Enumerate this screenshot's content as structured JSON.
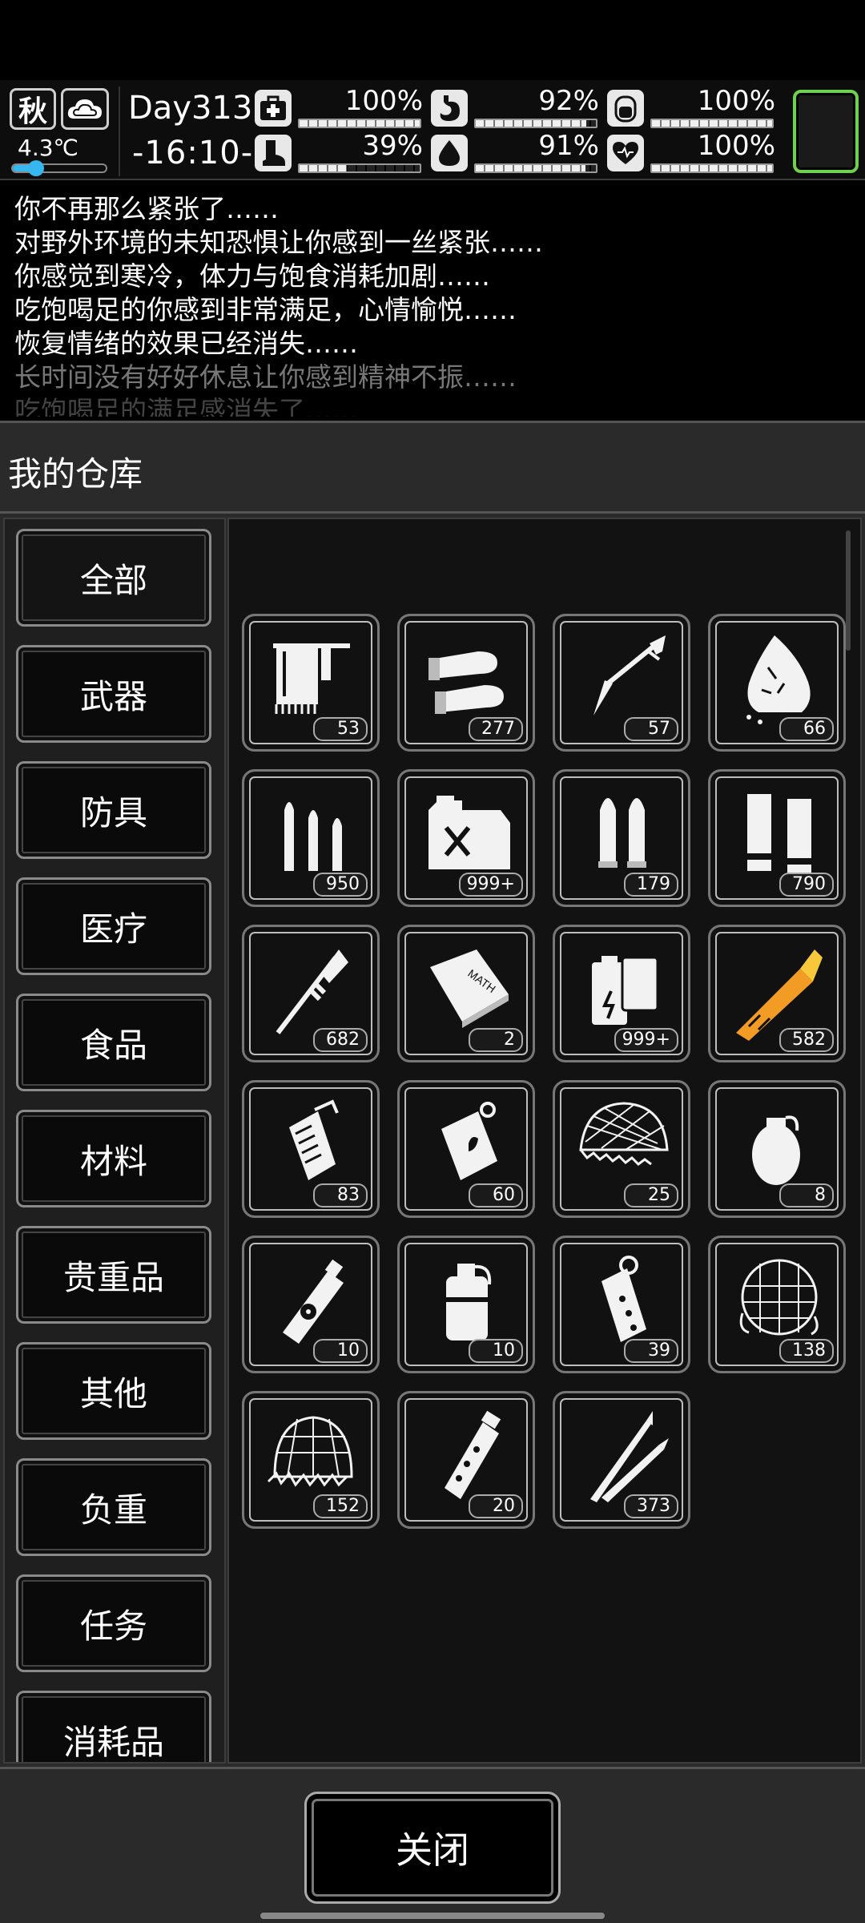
{
  "hud": {
    "season": "秋",
    "weather_icon": "cloud-icon",
    "temperature": "4.3℃",
    "temperature_level": 0.25,
    "day": "Day313",
    "clock": "-16:10-",
    "stats": [
      {
        "name": "health",
        "icon": "medkit-icon",
        "value": "100%",
        "level": 1.0
      },
      {
        "name": "hunger",
        "icon": "stomach-icon",
        "value": "92%",
        "level": 0.92
      },
      {
        "name": "armor",
        "icon": "battery-icon",
        "value": "100%",
        "level": 1.0
      },
      {
        "name": "stamina",
        "icon": "boot-icon",
        "value": "39%",
        "level": 0.39
      },
      {
        "name": "thirst",
        "icon": "water-drop-icon",
        "value": "91%",
        "level": 0.91
      },
      {
        "name": "mood",
        "icon": "heart-icon",
        "value": "100%",
        "level": 1.0
      }
    ]
  },
  "log": [
    "你不再那么紧张了……",
    "对野外环境的未知恐惧让你感到一丝紧张……",
    "你感觉到寒冷，体力与饱食消耗加剧……",
    "吃饱喝足的你感到非常满足，心情愉悦……",
    "恢复情绪的效果已经消失……",
    "长时间没有好好休息让你感到精神不振……",
    "吃饱喝足的满足感消失了……"
  ],
  "warehouse": {
    "title": "我的仓库",
    "categories": [
      "全部",
      "武器",
      "防具",
      "医疗",
      "食品",
      "材料",
      "贵重品",
      "其他",
      "负重",
      "任务",
      "消耗品"
    ],
    "items": [
      {
        "icon": "towel-icon",
        "count": "53"
      },
      {
        "icon": "shotgun-shells-icon",
        "count": "277"
      },
      {
        "icon": "arrow-icon",
        "count": "57"
      },
      {
        "icon": "cloth-rag-icon",
        "count": "66"
      },
      {
        "icon": "rifle-bullets-icon",
        "count": "950"
      },
      {
        "icon": "fuel-can-icon",
        "count": "999+"
      },
      {
        "icon": "pistol-bullets-icon",
        "count": "179"
      },
      {
        "icon": "magazine-rounds-icon",
        "count": "790"
      },
      {
        "icon": "rpg-rocket-icon",
        "count": "682"
      },
      {
        "icon": "math-book-icon",
        "count": "2"
      },
      {
        "icon": "battery-pack-icon",
        "count": "999+"
      },
      {
        "icon": "glue-tube-icon",
        "count": "582"
      },
      {
        "icon": "flashbang-grenade-icon",
        "count": "83"
      },
      {
        "icon": "incendiary-grenade-icon",
        "count": "60"
      },
      {
        "icon": "camo-net-icon",
        "count": "25"
      },
      {
        "icon": "frag-grenade-icon",
        "count": "8"
      },
      {
        "icon": "radiation-spray-icon",
        "count": "10"
      },
      {
        "icon": "smoke-grenade-icon",
        "count": "10"
      },
      {
        "icon": "stun-grenade-icon",
        "count": "39"
      },
      {
        "icon": "net-ball-icon",
        "count": "138"
      },
      {
        "icon": "spiked-net-icon",
        "count": "152"
      },
      {
        "icon": "cluster-grenade-icon",
        "count": "20"
      },
      {
        "icon": "sniper-rounds-icon",
        "count": "373"
      }
    ],
    "close_label": "关闭"
  }
}
